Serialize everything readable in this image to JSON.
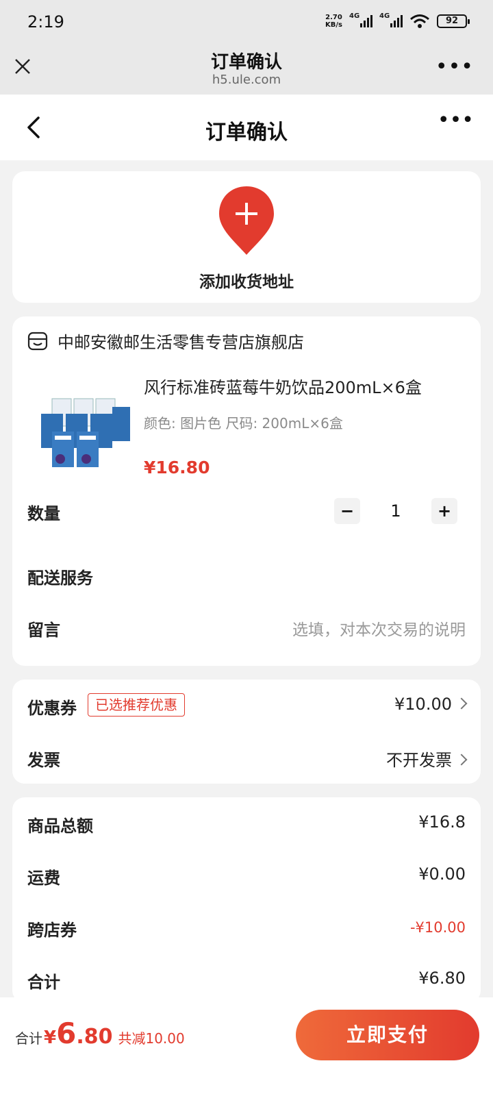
{
  "status_bar": {
    "time": "2:19",
    "net_speed_top": "2.70",
    "net_speed_bottom": "KB/s",
    "sim1": "4G",
    "sim2": "4G",
    "battery": "92"
  },
  "browser": {
    "title": "订单确认",
    "url": "h5.ule.com"
  },
  "header": {
    "title": "订单确认"
  },
  "address": {
    "add_label": "添加收货地址"
  },
  "store": {
    "name": "中邮安徽邮生活零售专营店旗舰店",
    "product": {
      "title": "风行标准砖蓝莓牛奶饮品200mL×6盒",
      "spec": "颜色: 图片色 尺码: 200mL×6盒",
      "price": "¥16.80"
    },
    "quantity_label": "数量",
    "quantity_value": "1",
    "minus": "−",
    "plus": "+",
    "delivery_label": "配送服务",
    "note_label": "留言",
    "note_placeholder": "选填，对本次交易的说明"
  },
  "coupon": {
    "label": "优惠券",
    "badge": "已选推荐优惠",
    "value": "¥10.00",
    "invoice_label": "发票",
    "invoice_value": "不开发票"
  },
  "summary": {
    "rows": [
      {
        "label": "商品总额",
        "value": "¥16.8"
      },
      {
        "label": "运费",
        "value": "¥0.00"
      },
      {
        "label": "跨店券",
        "value": "-¥10.00"
      },
      {
        "label": "合计",
        "value": "¥6.80"
      }
    ]
  },
  "bottom": {
    "total_label": "合计",
    "currency": "¥",
    "amount_int": "6",
    "amount_dec": ".80",
    "saved": "共减10.00",
    "pay_button": "立即支付"
  },
  "colors": {
    "accent": "#e23b2e",
    "accent_gradient_start": "#ef6a3a"
  }
}
